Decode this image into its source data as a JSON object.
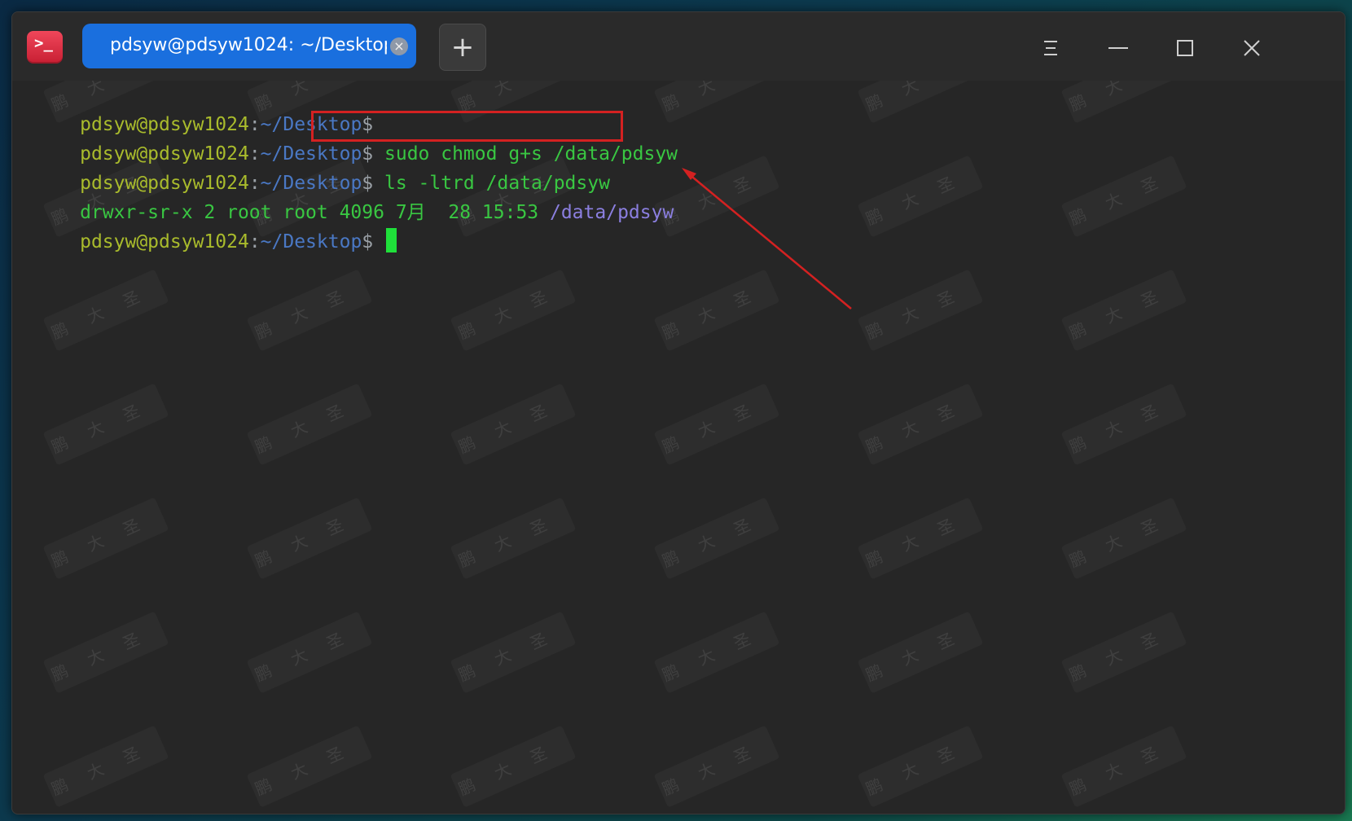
{
  "titlebar": {
    "app_icon_glyph": ">_",
    "tab_title": "pdsyw@pdsyw1024: ~/Desktop",
    "tab_close_glyph": "×",
    "new_tab_glyph": "+"
  },
  "window_controls": {
    "menu_icon": "menu-icon",
    "minimize_icon": "minimize-icon",
    "maximize_icon": "maximize-icon",
    "close_icon": "close-icon"
  },
  "terminal": {
    "lines": [
      {
        "user": "pdsyw@pdsyw1024",
        "colon": ":",
        "path": "~/Desktop",
        "dollar": "$",
        "command": ""
      },
      {
        "user": "pdsyw@pdsyw1024",
        "colon": ":",
        "path": "~/Desktop",
        "dollar": "$",
        "command": " sudo chmod g+s /data/pdsyw"
      },
      {
        "user": "pdsyw@pdsyw1024",
        "colon": ":",
        "path": "~/Desktop",
        "dollar": "$",
        "command": " ls -ltrd /data/pdsyw"
      },
      {
        "output_text": "drwxr-sr-x 2 root root 4096 7月  28 15:53 ",
        "output_dir": "/data/pdsyw"
      },
      {
        "user": "pdsyw@pdsyw1024",
        "colon": ":",
        "path": "~/Desktop",
        "dollar": "$",
        "command": ""
      }
    ]
  },
  "watermark_text": "鹏大圣",
  "colors": {
    "terminal_bg": "#262626",
    "user": "#a9bb2c",
    "path": "#4a78c4",
    "command": "#39c742",
    "directory": "#8b7fe0",
    "tab_active": "#1a6fde",
    "annotation": "#d42121"
  }
}
